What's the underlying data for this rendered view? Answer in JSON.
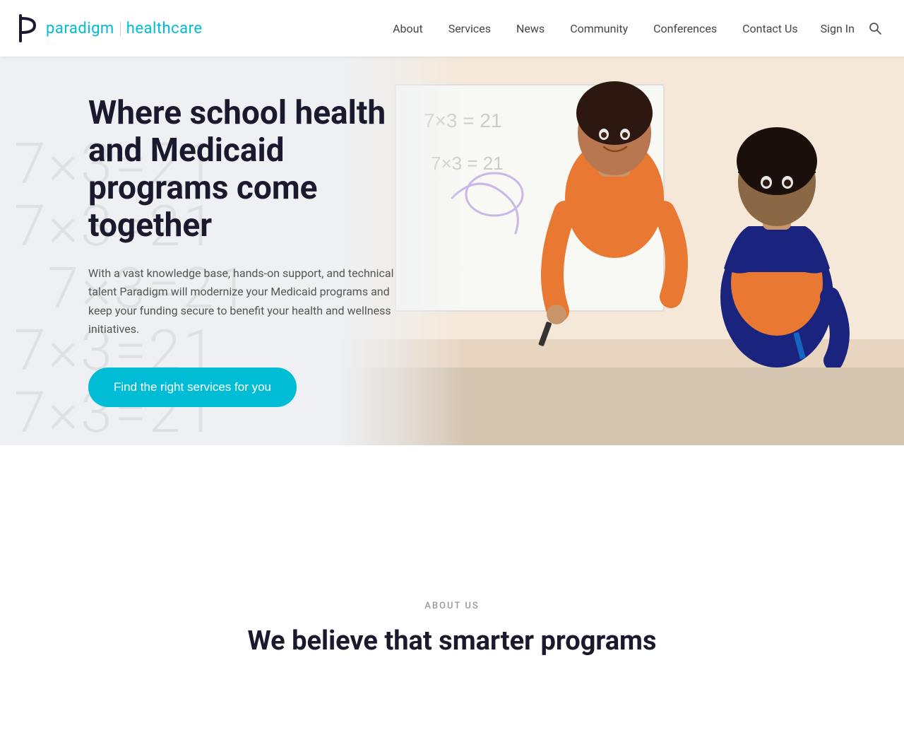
{
  "header": {
    "logo_brand": "paradigm",
    "logo_healthcare": "healthcare",
    "nav_items": [
      {
        "label": "About",
        "id": "about"
      },
      {
        "label": "Services",
        "id": "services"
      },
      {
        "label": "News",
        "id": "news"
      },
      {
        "label": "Community",
        "id": "community"
      },
      {
        "label": "Conferences",
        "id": "conferences"
      },
      {
        "label": "Contact Us",
        "id": "contact"
      },
      {
        "label": "Sign In",
        "id": "signin"
      }
    ]
  },
  "hero": {
    "title": "Where school health and Medicaid programs come together",
    "subtitle": "With a vast knowledge base, hands-on support, and technical talent Paradigm will modernize your Medicaid programs and keep your funding secure to benefit your health and wellness initiatives.",
    "cta_label": "Find the right services for you",
    "math_bg": "7×3=21\n7×3=21\n7×3=21\n7×3=21\n7×3=21"
  },
  "about_section": {
    "label": "ABOUT US",
    "title": "We believe that smarter programs"
  },
  "colors": {
    "teal": "#00bcd4",
    "dark": "#1a1a2e",
    "gray": "#555",
    "light_bg": "#eef0f3"
  }
}
